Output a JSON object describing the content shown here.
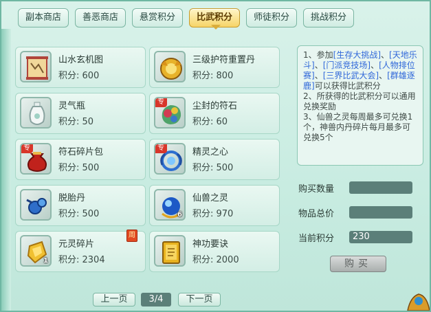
{
  "tabs": [
    {
      "label": "副本商店",
      "active": false
    },
    {
      "label": "善恶商店",
      "active": false
    },
    {
      "label": "悬赏积分",
      "active": false
    },
    {
      "label": "比武积分",
      "active": true
    },
    {
      "label": "师徒积分",
      "active": false
    },
    {
      "label": "挑战积分",
      "active": false
    }
  ],
  "items": [
    {
      "name": "山水玄机图",
      "cost": "积分: 600",
      "icon": "scroll-map-icon"
    },
    {
      "name": "三级护符重置丹",
      "cost": "积分: 800",
      "icon": "golden-pill-icon"
    },
    {
      "name": "灵气瓶",
      "cost": "积分: 50",
      "icon": "vase-icon"
    },
    {
      "name": "尘封的符石",
      "cost": "积分: 60",
      "icon": "rune-stone-icon",
      "badge": "专"
    },
    {
      "name": "符石碎片包",
      "cost": "积分: 500",
      "icon": "red-pouch-icon",
      "badge": "专"
    },
    {
      "name": "精灵之心",
      "cost": "积分: 500",
      "icon": "spirit-heart-icon",
      "badge": "专"
    },
    {
      "name": "脱胎丹",
      "cost": "积分: 500",
      "icon": "blue-pill-icon"
    },
    {
      "name": "仙兽之灵",
      "cost": "积分: 970",
      "icon": "blue-orb-icon",
      "qty": "6"
    },
    {
      "name": "元灵碎片",
      "cost": "积分: 2304",
      "icon": "gold-shard-icon",
      "qty": "1",
      "week_badge": "周"
    },
    {
      "name": "神功要诀",
      "cost": "积分: 2000",
      "icon": "gold-book-icon"
    }
  ],
  "info": {
    "line1_prefix": "1、参加",
    "e1": "[生存大挑战]",
    "sep1": "、",
    "e2": "[天地乐斗]",
    "sep2": "、",
    "e3": "[门派竞技场]",
    "sep3": "、",
    "e4": "[人物排位赛]",
    "sep4": "、",
    "e5": "[三界比武大会]",
    "sep5": "、",
    "e6": "[群雄逐鹿]",
    "line1_suffix": "可以获得比武积分",
    "line2": "2、所获得的比武积分可以通用兑换奖励",
    "line3": "3、仙兽之灵每周最多可兑换1个，神兽内丹碎片每月最多可兑换5个"
  },
  "purchase": {
    "qty_label": "购买数量",
    "qty_value": "",
    "total_label": "物品总价",
    "total_value": "",
    "points_label": "当前积分",
    "points_value": "230",
    "buy_label": "购买"
  },
  "pager": {
    "prev": "上一页",
    "indicator": "3/4",
    "next": "下一页"
  },
  "colors": {
    "accent_gold": "#f6d468",
    "link_blue": "#2f67d9",
    "badge_red": "#d8362a",
    "field_bg": "#5b7f79"
  }
}
